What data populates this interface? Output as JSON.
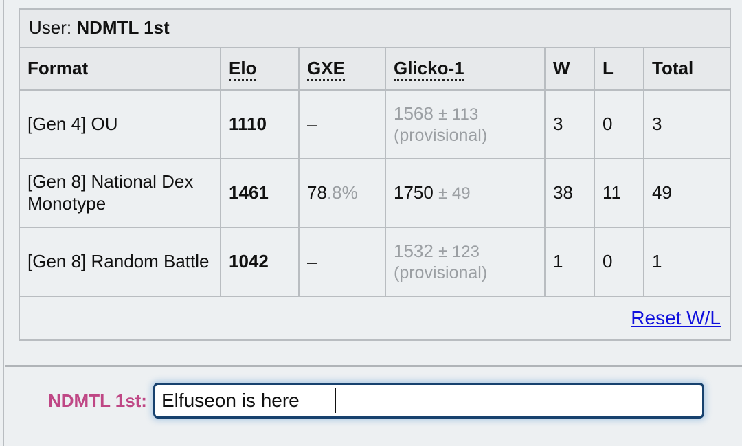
{
  "panel": {
    "user_label": "User:",
    "username": "NDMTL 1st"
  },
  "table": {
    "headers": {
      "format": "Format",
      "elo": "Elo",
      "gxe": "GXE",
      "glicko": "Glicko-1",
      "w": "W",
      "l": "L",
      "total": "Total"
    },
    "rows": [
      {
        "format": "[Gen 4] OU",
        "elo": "1110",
        "gxe": "–",
        "gxe_frac": "",
        "glicko": "1568",
        "glicko_dev": "± 113",
        "provisional": "(provisional)",
        "w": "3",
        "l": "0",
        "total": "3"
      },
      {
        "format": "[Gen 8] National Dex Monotype",
        "elo": "1461",
        "gxe": "78",
        "gxe_frac": ".8%",
        "glicko": "1750",
        "glicko_dev": "± 49",
        "provisional": "",
        "w": "38",
        "l": "11",
        "total": "49"
      },
      {
        "format": "[Gen 8] Random Battle",
        "elo": "1042",
        "gxe": "–",
        "gxe_frac": "",
        "glicko": "1532",
        "glicko_dev": "± 123",
        "provisional": "(provisional)",
        "w": "1",
        "l": "0",
        "total": "1"
      }
    ],
    "reset_link": "Reset W/L"
  },
  "chat": {
    "username_label": "NDMTL 1st:",
    "input_value": "Elfuseon is here",
    "input_placeholder": ""
  },
  "colors": {
    "page_background": "#edf0f2",
    "border": "#b9bdc1",
    "header_background": "#e7e9eb",
    "muted_text": "#9b9fa3",
    "link": "#1010dd",
    "chat_username": "#bf4785",
    "input_border": "#17416e"
  }
}
